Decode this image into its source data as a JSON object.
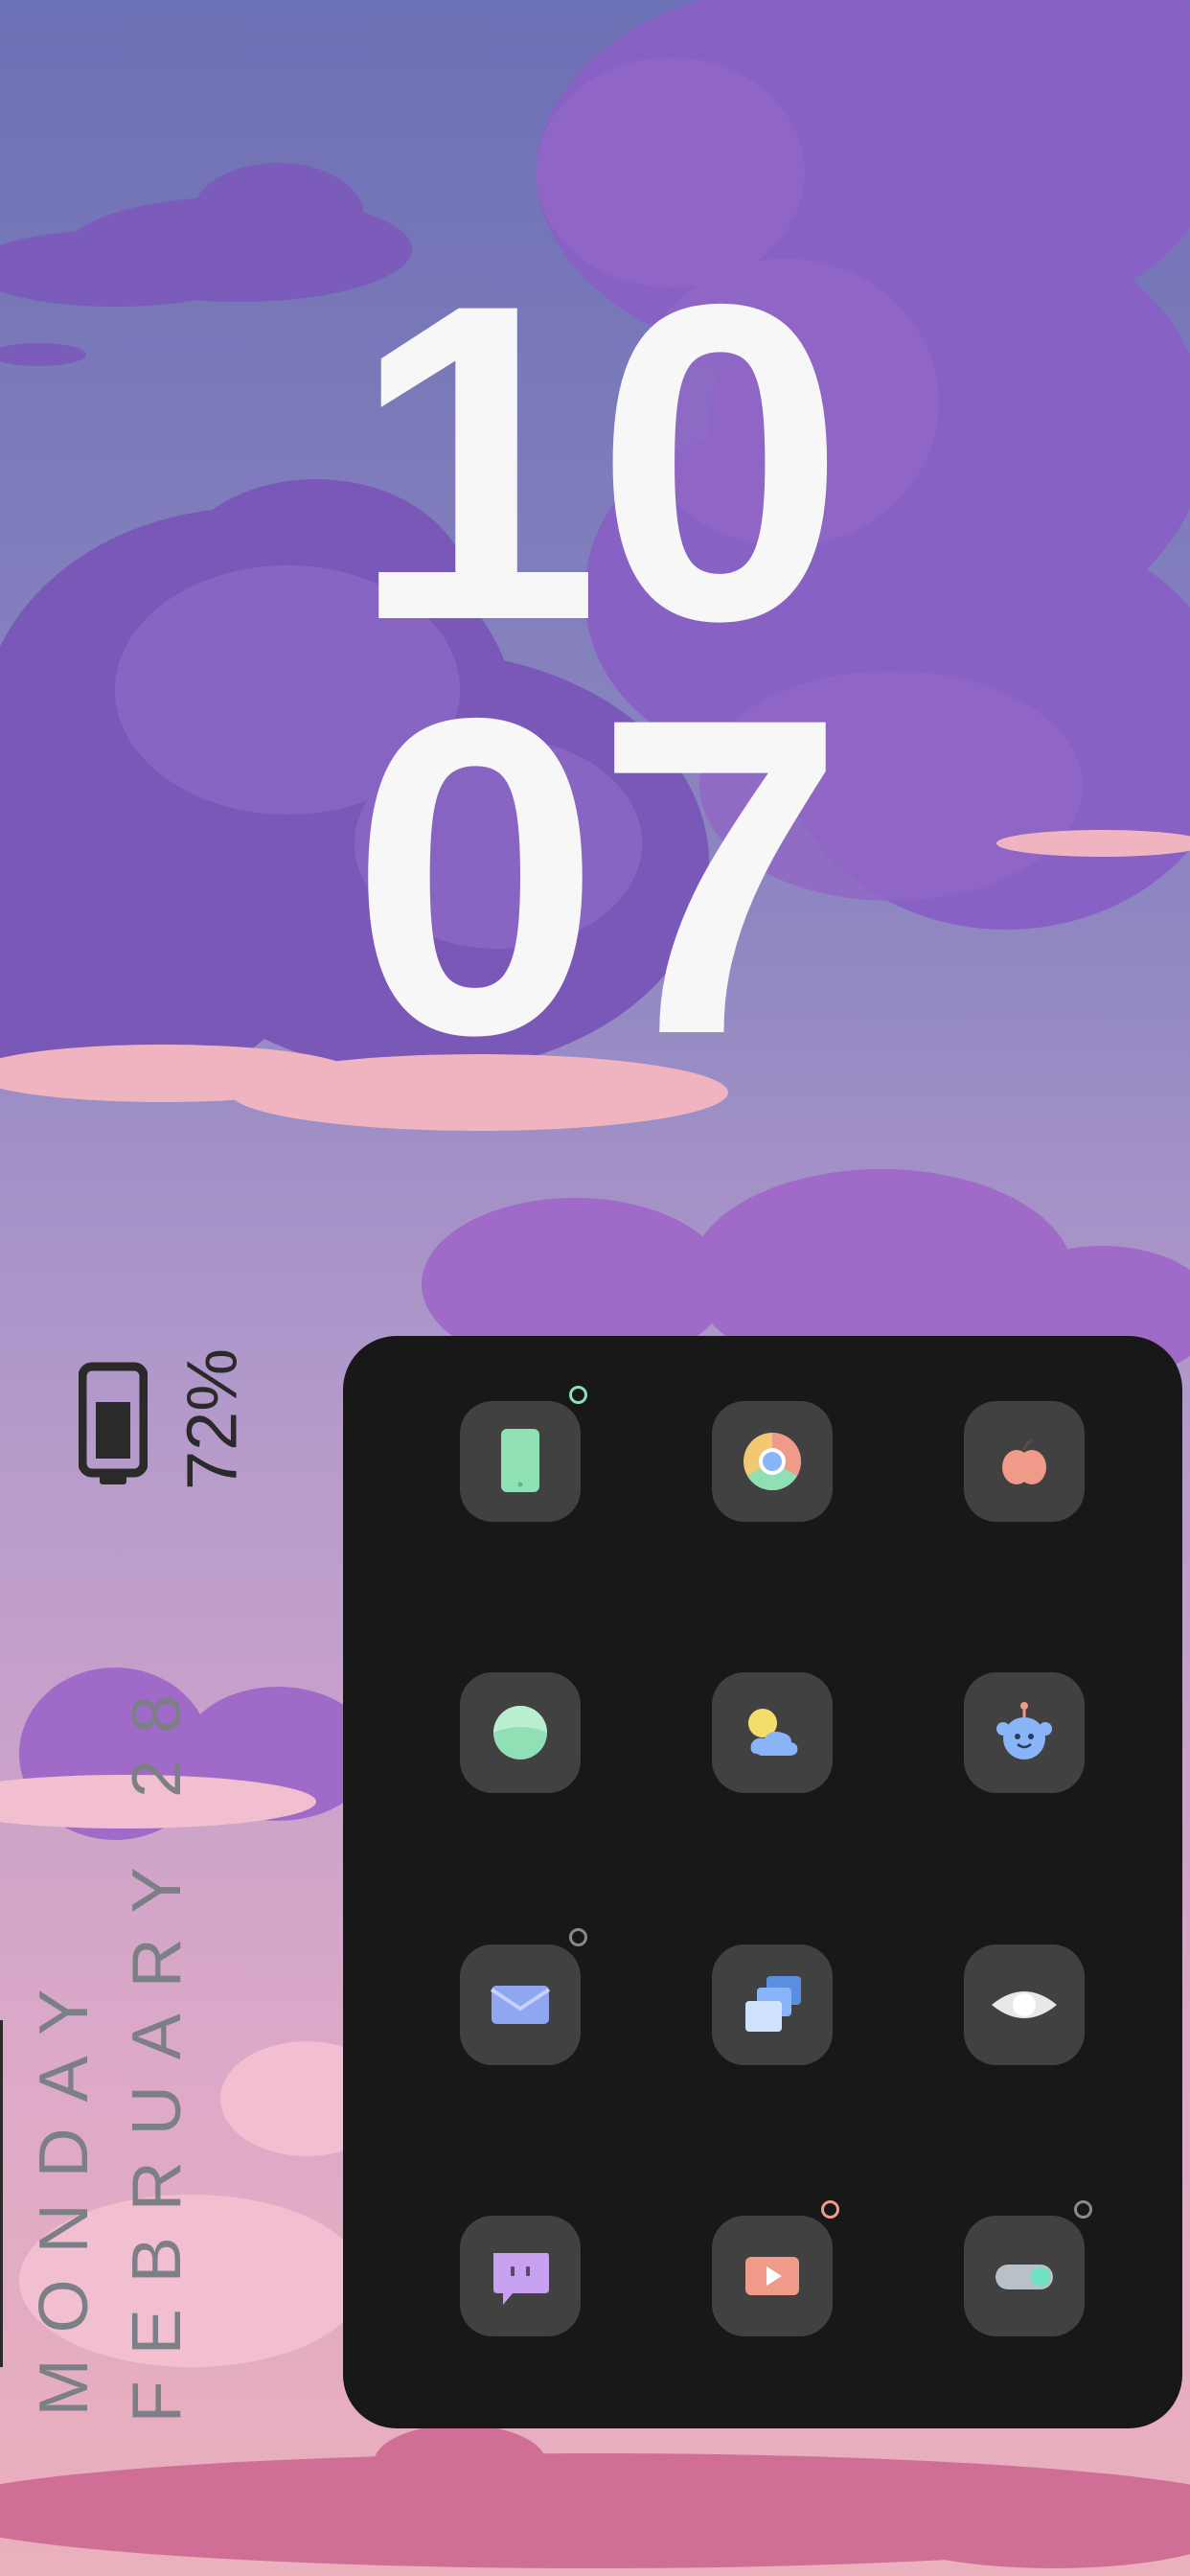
{
  "clock": {
    "hours": "10",
    "minutes": "07"
  },
  "battery": {
    "percent_label": "72%",
    "icon": "battery-icon",
    "level": 0.72
  },
  "date": {
    "weekday": "MONDAY",
    "month_day": "FEBRUARY 28"
  },
  "apps": [
    {
      "name": "phone-app-icon",
      "notification": true,
      "dot_color": "#8fe0b4"
    },
    {
      "name": "chrome-app-icon",
      "notification": false
    },
    {
      "name": "apple-app-icon",
      "notification": false
    },
    {
      "name": "green-circle-app-icon",
      "notification": false
    },
    {
      "name": "weather-app-icon",
      "notification": false
    },
    {
      "name": "bot-app-icon",
      "notification": false
    },
    {
      "name": "mail-app-icon",
      "notification": true,
      "dot_color": "#8a8a8a"
    },
    {
      "name": "gallery-app-icon",
      "notification": false
    },
    {
      "name": "eye-app-icon",
      "notification": false
    },
    {
      "name": "chat-app-icon",
      "notification": false
    },
    {
      "name": "youtube-app-icon",
      "notification": true,
      "dot_color": "#f09a8a"
    },
    {
      "name": "toggle-app-icon",
      "notification": true,
      "dot_color": "#8a8a8a"
    }
  ],
  "colors": {
    "panel": "#181818",
    "tile": "#414141",
    "clock_text": "#f7f7f7",
    "date_text": "#7d7f86"
  }
}
